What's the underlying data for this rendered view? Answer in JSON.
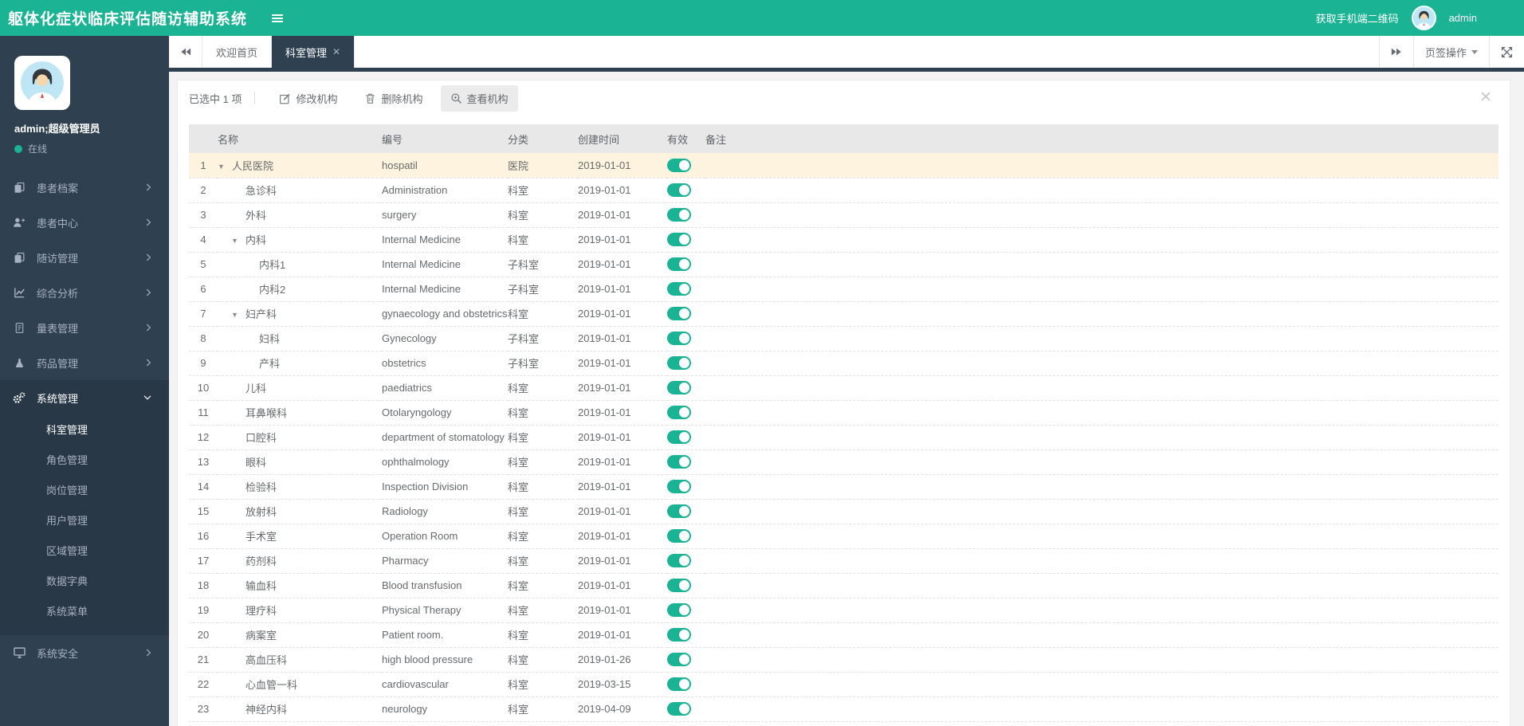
{
  "header": {
    "title": "躯体化症状临床评估随访辅助系统",
    "qr_link": "获取手机端二维码",
    "username": "admin"
  },
  "sidebar": {
    "profile": {
      "name": "admin;超级管理员",
      "status": "在线"
    },
    "items": [
      {
        "label": "患者档案",
        "icon": "copy-icon",
        "chevron": "right"
      },
      {
        "label": "患者中心",
        "icon": "user-plus-icon",
        "chevron": "right"
      },
      {
        "label": "随访管理",
        "icon": "copy-icon",
        "chevron": "right"
      },
      {
        "label": "综合分析",
        "icon": "line-chart-icon",
        "chevron": "right"
      },
      {
        "label": "量表管理",
        "icon": "file-text-icon",
        "chevron": "right"
      },
      {
        "label": "药品管理",
        "icon": "flask-icon",
        "chevron": "right"
      },
      {
        "label": "系统管理",
        "icon": "gears-icon",
        "chevron": "down",
        "expanded": true,
        "children": [
          {
            "label": "科室管理",
            "active": true
          },
          {
            "label": "角色管理"
          },
          {
            "label": "岗位管理"
          },
          {
            "label": "用户管理"
          },
          {
            "label": "区域管理"
          },
          {
            "label": "数据字典"
          },
          {
            "label": "系统菜单"
          }
        ]
      },
      {
        "label": "系统安全",
        "icon": "desktop-icon",
        "chevron": "right"
      }
    ]
  },
  "tabbar": {
    "tabs": [
      {
        "label": "欢迎首页",
        "active": false
      },
      {
        "label": "科室管理",
        "active": true,
        "closable": true
      }
    ],
    "right_menu_label": "页签操作"
  },
  "toolbar": {
    "selection_text": "已选中 1 项",
    "buttons": [
      {
        "label": "修改机构",
        "icon": "edit-icon"
      },
      {
        "label": "删除机构",
        "icon": "trash-icon"
      },
      {
        "label": "查看机构",
        "icon": "search-plus-icon",
        "highlighted": true
      }
    ]
  },
  "table": {
    "columns": [
      "名称",
      "编号",
      "分类",
      "创建时间",
      "有效",
      "备注"
    ],
    "rows": [
      {
        "index": 1,
        "depth": 0,
        "expandable": true,
        "selected": true,
        "name": "人民医院",
        "code": "hospatil",
        "category": "医院",
        "created": "2019-01-01",
        "valid": true,
        "note": ""
      },
      {
        "index": 2,
        "depth": 1,
        "expandable": false,
        "selected": false,
        "name": "急诊科",
        "code": "Administration",
        "category": "科室",
        "created": "2019-01-01",
        "valid": true,
        "note": ""
      },
      {
        "index": 3,
        "depth": 1,
        "expandable": false,
        "selected": false,
        "name": "外科",
        "code": "surgery",
        "category": "科室",
        "created": "2019-01-01",
        "valid": true,
        "note": ""
      },
      {
        "index": 4,
        "depth": 1,
        "expandable": true,
        "selected": false,
        "name": "内科",
        "code": "Internal Medicine",
        "category": "科室",
        "created": "2019-01-01",
        "valid": true,
        "note": ""
      },
      {
        "index": 5,
        "depth": 2,
        "expandable": false,
        "selected": false,
        "name": "内科1",
        "code": "Internal Medicine",
        "category": "子科室",
        "created": "2019-01-01",
        "valid": true,
        "note": ""
      },
      {
        "index": 6,
        "depth": 2,
        "expandable": false,
        "selected": false,
        "name": "内科2",
        "code": "Internal Medicine",
        "category": "子科室",
        "created": "2019-01-01",
        "valid": true,
        "note": ""
      },
      {
        "index": 7,
        "depth": 1,
        "expandable": true,
        "selected": false,
        "name": "妇产科",
        "code": "gynaecology and obstetrics",
        "category": "科室",
        "created": "2019-01-01",
        "valid": true,
        "note": ""
      },
      {
        "index": 8,
        "depth": 2,
        "expandable": false,
        "selected": false,
        "name": "妇科",
        "code": "Gynecology",
        "category": "子科室",
        "created": "2019-01-01",
        "valid": true,
        "note": ""
      },
      {
        "index": 9,
        "depth": 2,
        "expandable": false,
        "selected": false,
        "name": "产科",
        "code": "obstetrics",
        "category": "子科室",
        "created": "2019-01-01",
        "valid": true,
        "note": ""
      },
      {
        "index": 10,
        "depth": 1,
        "expandable": false,
        "selected": false,
        "name": "儿科",
        "code": "paediatrics",
        "category": "科室",
        "created": "2019-01-01",
        "valid": true,
        "note": ""
      },
      {
        "index": 11,
        "depth": 1,
        "expandable": false,
        "selected": false,
        "name": "耳鼻喉科",
        "code": "Otolaryngology",
        "category": "科室",
        "created": "2019-01-01",
        "valid": true,
        "note": ""
      },
      {
        "index": 12,
        "depth": 1,
        "expandable": false,
        "selected": false,
        "name": "口腔科",
        "code": "department of stomatology",
        "category": "科室",
        "created": "2019-01-01",
        "valid": true,
        "note": ""
      },
      {
        "index": 13,
        "depth": 1,
        "expandable": false,
        "selected": false,
        "name": "眼科",
        "code": "ophthalmology",
        "category": "科室",
        "created": "2019-01-01",
        "valid": true,
        "note": ""
      },
      {
        "index": 14,
        "depth": 1,
        "expandable": false,
        "selected": false,
        "name": "检验科",
        "code": "Inspection Division",
        "category": "科室",
        "created": "2019-01-01",
        "valid": true,
        "note": ""
      },
      {
        "index": 15,
        "depth": 1,
        "expandable": false,
        "selected": false,
        "name": "放射科",
        "code": "Radiology",
        "category": "科室",
        "created": "2019-01-01",
        "valid": true,
        "note": ""
      },
      {
        "index": 16,
        "depth": 1,
        "expandable": false,
        "selected": false,
        "name": "手术室",
        "code": " Operation Room",
        "category": "科室",
        "created": "2019-01-01",
        "valid": true,
        "note": ""
      },
      {
        "index": 17,
        "depth": 1,
        "expandable": false,
        "selected": false,
        "name": "药剂科",
        "code": "Pharmacy",
        "category": "科室",
        "created": "2019-01-01",
        "valid": true,
        "note": ""
      },
      {
        "index": 18,
        "depth": 1,
        "expandable": false,
        "selected": false,
        "name": "输血科",
        "code": "Blood transfusion",
        "category": "科室",
        "created": "2019-01-01",
        "valid": true,
        "note": ""
      },
      {
        "index": 19,
        "depth": 1,
        "expandable": false,
        "selected": false,
        "name": "理疗科",
        "code": "Physical Therapy",
        "category": "科室",
        "created": "2019-01-01",
        "valid": true,
        "note": ""
      },
      {
        "index": 20,
        "depth": 1,
        "expandable": false,
        "selected": false,
        "name": "病案室",
        "code": "Patient room.",
        "category": "科室",
        "created": "2019-01-01",
        "valid": true,
        "note": ""
      },
      {
        "index": 21,
        "depth": 1,
        "expandable": false,
        "selected": false,
        "name": "高血压科",
        "code": "high blood pressure",
        "category": "科室",
        "created": "2019-01-26",
        "valid": true,
        "note": ""
      },
      {
        "index": 22,
        "depth": 1,
        "expandable": false,
        "selected": false,
        "name": "心血管一科",
        "code": "cardiovascular",
        "category": "科室",
        "created": "2019-03-15",
        "valid": true,
        "note": ""
      },
      {
        "index": 23,
        "depth": 1,
        "expandable": false,
        "selected": false,
        "name": "神经内科",
        "code": "neurology",
        "category": "科室",
        "created": "2019-04-09",
        "valid": true,
        "note": ""
      }
    ]
  },
  "colors": {
    "accent": "#1ab394",
    "sidebar_bg": "#2f4050",
    "sidebar_open_bg": "#293846",
    "selected_row_bg": "#fdf3df",
    "content_bg": "#f3f3f4"
  }
}
